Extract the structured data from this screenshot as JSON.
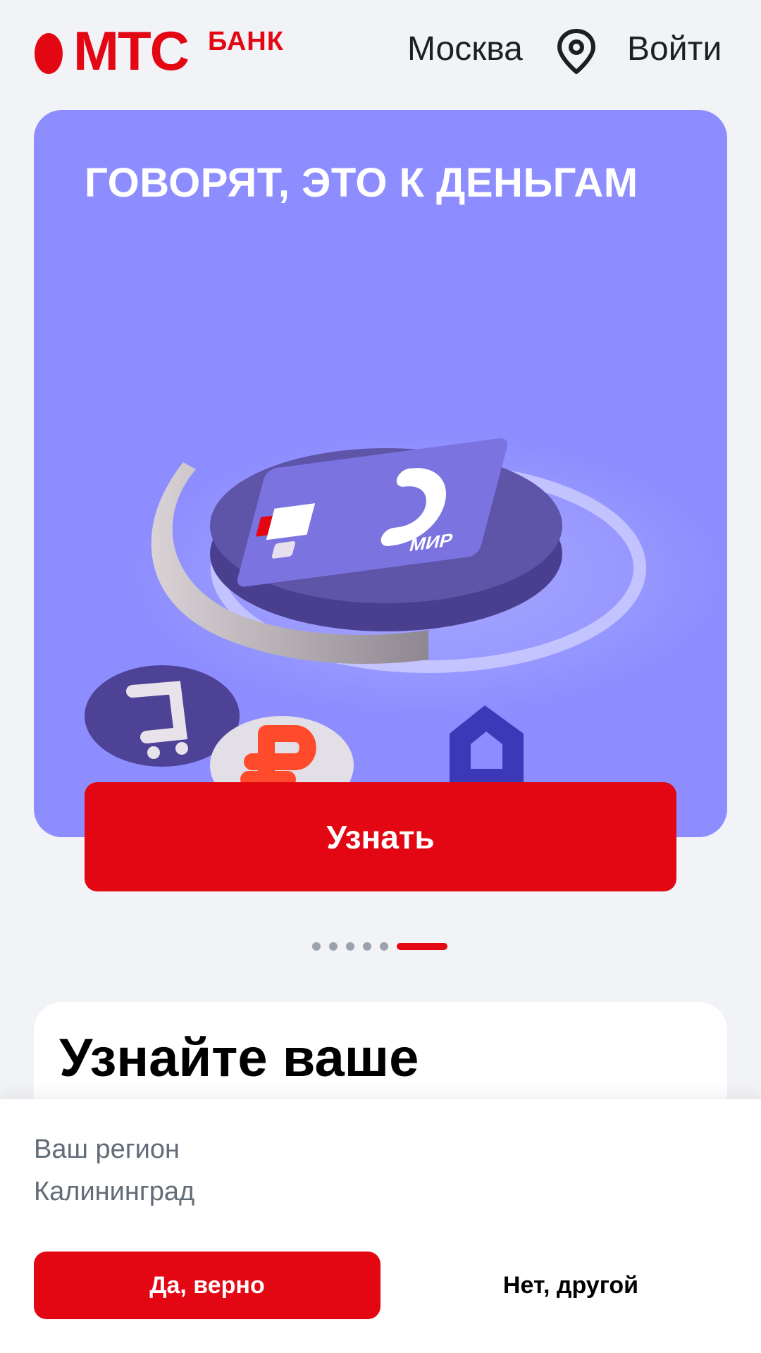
{
  "header": {
    "logo_text": "МТС",
    "logo_sub": "БАНК",
    "city": "Москва",
    "login": "Войти"
  },
  "banner": {
    "title": "ГОВОРЯТ, ЭТО К ДЕНЬГАМ",
    "cta_label": "Узнать",
    "card_brand": "МИР",
    "background_color": "#8d8dff"
  },
  "pagination": {
    "total": 6,
    "active_index": 6
  },
  "promo_card": {
    "title": "Узнайте ваше"
  },
  "region_sheet": {
    "label": "Ваш регион",
    "value": "Калининград",
    "confirm_label": "Да, верно",
    "other_label": "Нет, другой"
  },
  "colors": {
    "brand_red": "#e30613",
    "page_bg": "#f2f3f7",
    "muted_text": "#626c77"
  }
}
